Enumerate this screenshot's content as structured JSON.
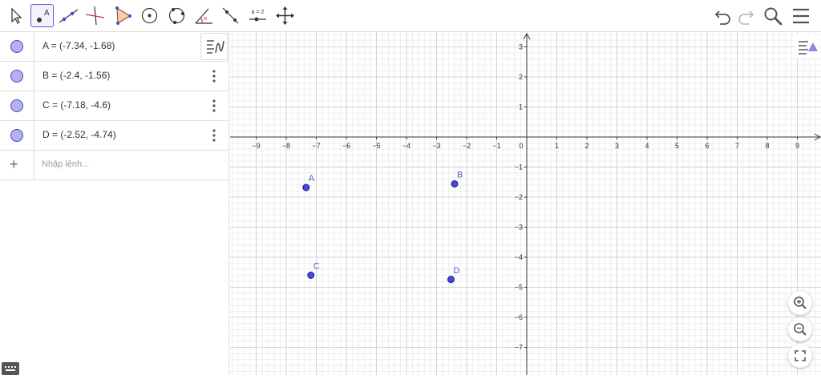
{
  "toolbar": {
    "tools": [
      "move-tool",
      "point-tool",
      "line-tool",
      "perpendicular-line-tool",
      "polygon-tool",
      "circle-center-tool",
      "circle-three-points-tool",
      "angle-tool",
      "reflect-tool",
      "slider-tool",
      "move-graphics-tool"
    ],
    "selected_tool": "point-tool",
    "point_tool_label": "A",
    "slider_tool_label": "a = 2"
  },
  "algebra": {
    "items": [
      {
        "label": "A = (-7.34, -1.68)"
      },
      {
        "label": "B = (-2.4, -1.56)"
      },
      {
        "label": "C = (-7.18, -4.6)"
      },
      {
        "label": "D = (-2.52, -4.74)"
      }
    ],
    "input_placeholder": "Nhập lệnh..."
  },
  "graph": {
    "x_range": [
      -9.6,
      9.9
    ],
    "y_range": [
      -7.8,
      3.4
    ],
    "x_ticks": [
      -9,
      -8,
      -7,
      -6,
      -5,
      -4,
      -3,
      -2,
      -1,
      0,
      1,
      2,
      3,
      4,
      5,
      6,
      7,
      8,
      9
    ],
    "y_ticks": [
      3,
      2,
      1,
      -1,
      -2,
      -3,
      -4,
      -5,
      -6,
      -7
    ],
    "points": [
      {
        "name": "A",
        "x": -7.34,
        "y": -1.68
      },
      {
        "name": "B",
        "x": -2.4,
        "y": -1.56
      },
      {
        "name": "C",
        "x": -7.18,
        "y": -4.6
      },
      {
        "name": "D",
        "x": -2.52,
        "y": -4.74
      }
    ],
    "point_color": "#4b47d8",
    "label_color": "#5b57d0"
  }
}
